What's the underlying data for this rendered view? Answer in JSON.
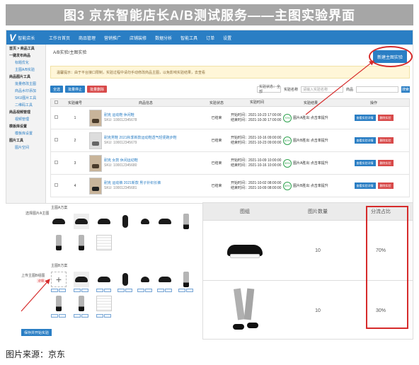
{
  "figure": {
    "title": "图3 京东智能店长A/B测试服务——主图实验界面",
    "source": "图片来源：京东"
  },
  "app": {
    "logo_text": "智能店长",
    "nav": [
      "工作台首页",
      "商品管理",
      "营销推广",
      "店铺装修",
      "数据分析",
      "智能工具",
      "订单",
      "设置"
    ],
    "sidebar": [
      {
        "label": "首页 > 商品工具",
        "type": "h"
      },
      {
        "label": "一键发布商品",
        "type": "h"
      },
      {
        "label": "标题优化",
        "type": "sub"
      },
      {
        "label": "主图A/B实验",
        "type": "sub"
      },
      {
        "label": "商品图片工具",
        "type": "h"
      },
      {
        "label": "批量修改主图",
        "type": "sub"
      },
      {
        "label": "商品水印添加",
        "type": "sub"
      },
      {
        "label": "SKU图片工具",
        "type": "sub"
      },
      {
        "label": "二维码工具",
        "type": "sub"
      },
      {
        "label": "商品视频管理",
        "type": "h"
      },
      {
        "label": "视频管理",
        "type": "sub"
      },
      {
        "label": "模板库设置",
        "type": "h"
      },
      {
        "label": "模板库设置",
        "type": "sub"
      },
      {
        "label": "图片工具",
        "type": "h"
      },
      {
        "label": "图片空间",
        "type": "sub"
      }
    ],
    "breadcrumb": "A/B实验/主图实验",
    "new_button": "新建主图实验",
    "notice": "温馨提示：由于平台接口限制，实验过程中请勿手动修改商品主图，以免影响实验结果，去查看",
    "toolbar": {
      "btn1": "全选",
      "btn2": "批量停止",
      "btn3": "批量删除"
    },
    "filters": {
      "status_select": "实验状态：全部",
      "search_label": "实验名称",
      "search_placeholder": "请输入实验名称",
      "search_label2": "商品",
      "search_btn": "搜索"
    },
    "table": {
      "headers": [
        "全选",
        "实验编号",
        "商品信息",
        "实验状态",
        "实验时间",
        "实验结果",
        "操作"
      ],
      "rows": [
        {
          "id": "1",
          "title": "耐克 运动鞋 休闲鞋",
          "sku": "SKU: 100012345678",
          "status": "已结束",
          "start": "开始时间：2021-10-23 17:00:00",
          "end": "结束时间：2021-10-30 17:00:00",
          "result_pct": "70%",
          "result_text": "图片A胜出 点击率提升",
          "op1": "查看实验详情",
          "op2": "删除实验",
          "thumb": "brown"
        },
        {
          "id": "2",
          "title": "耐克男鞋 2021秋季新款运动鞋透气轻便跑步鞋",
          "sku": "SKU: 100012345679",
          "status": "已结束",
          "start": "开始时间：2021-10-16 09:00:00",
          "end": "结束时间：2021-10-23 09:00:00",
          "result_pct": "60%",
          "result_text": "图片B胜出 点击率提升",
          "op1": "查看实验详情",
          "op2": "删除实验",
          "thumb": "gray"
        },
        {
          "id": "3",
          "title": "耐克 女款 休闲运动鞋",
          "sku": "SKU: 100012345680",
          "status": "已结束",
          "start": "开始时间：2021-10-09 10:00:00",
          "end": "结束时间：2021-10-16 10:00:00",
          "result_pct": "55%",
          "result_text": "图片A胜出 点击率提升",
          "op1": "查看实验详情",
          "op2": "删除实验",
          "thumb": "brown"
        },
        {
          "id": "4",
          "title": "耐克 运动裤 2021新款 男子针织长裤",
          "sku": "SKU: 100012345681",
          "status": "已结束",
          "start": "开始时间：2021-10-02 08:00:00",
          "end": "结束时间：2021-10-09 08:00:00",
          "result_pct": "65%",
          "result_text": "图片B胜出 点击率提升",
          "op1": "查看实验详情",
          "op2": "删除实验",
          "thumb": "black"
        }
      ]
    }
  },
  "editor": {
    "group_a_label": "选择图片A主图",
    "group_a_title": "主图A方案",
    "group_b_label": "上传主图B组图",
    "group_b_title": "主图B方案",
    "required": "必填",
    "submit": "保存并开始实验"
  },
  "result_table": {
    "headers": [
      "图组",
      "图片数量",
      "分流占比"
    ],
    "rows": [
      {
        "count": "10",
        "ratio": "70%"
      },
      {
        "count": "10",
        "ratio": "30%"
      }
    ]
  }
}
